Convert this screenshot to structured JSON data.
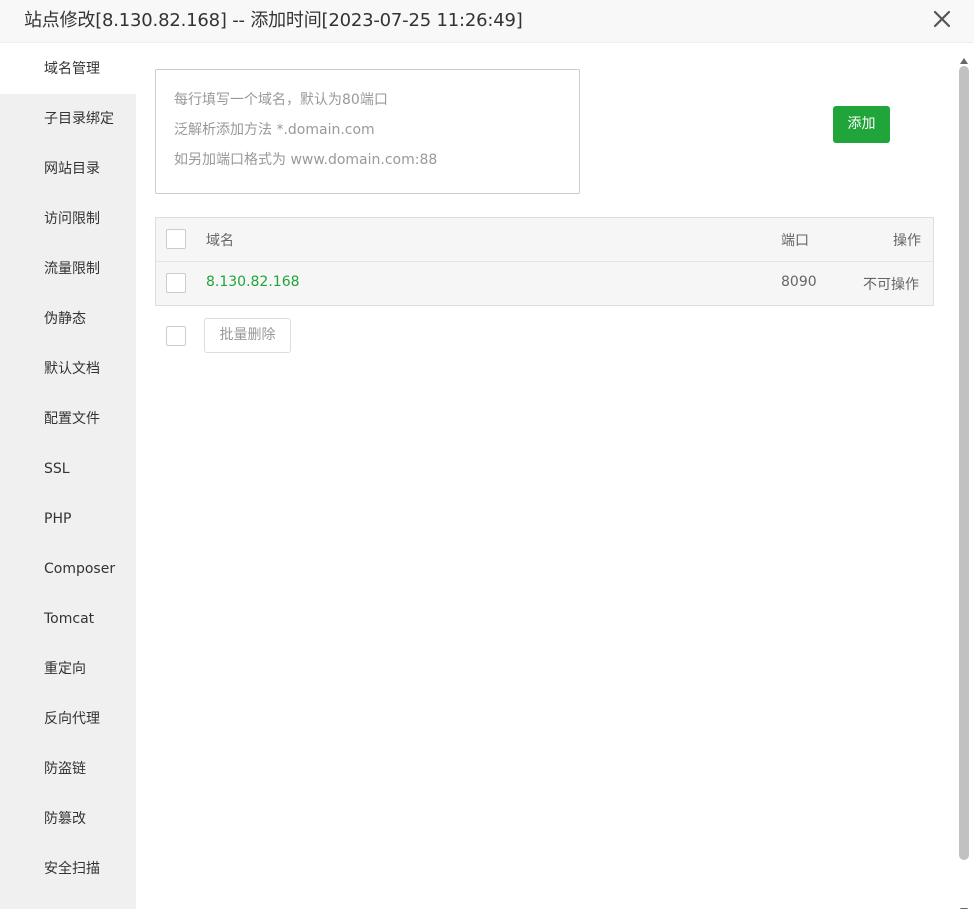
{
  "dialog": {
    "title": "站点修改[8.130.82.168] -- 添加时间[2023-07-25 11:26:49]",
    "close_icon": "close-icon"
  },
  "sidebar": {
    "items": [
      {
        "label": "域名管理",
        "active": true
      },
      {
        "label": "子目录绑定"
      },
      {
        "label": "网站目录"
      },
      {
        "label": "访问限制"
      },
      {
        "label": "流量限制"
      },
      {
        "label": "伪静态"
      },
      {
        "label": "默认文档"
      },
      {
        "label": "配置文件"
      },
      {
        "label": "SSL"
      },
      {
        "label": "PHP"
      },
      {
        "label": "Composer"
      },
      {
        "label": "Tomcat"
      },
      {
        "label": "重定向"
      },
      {
        "label": "反向代理"
      },
      {
        "label": "防盗链"
      },
      {
        "label": "防篡改"
      },
      {
        "label": "安全扫描"
      }
    ]
  },
  "domain_input": {
    "placeholder_lines": [
      "每行填写一个域名，默认为80端口",
      "泛解析添加方法 *.domain.com",
      "如另加端口格式为 www.domain.com:88"
    ],
    "value": ""
  },
  "add_button": "添加",
  "table": {
    "headers": {
      "domain": "域名",
      "port": "端口",
      "action": "操作"
    },
    "rows": [
      {
        "domain": "8.130.82.168",
        "port": "8090",
        "action": "不可操作"
      }
    ]
  },
  "bulk_delete_button": "批量删除",
  "colors": {
    "accent": "#20a53a",
    "sidebar_bg": "#f0f0f0"
  }
}
